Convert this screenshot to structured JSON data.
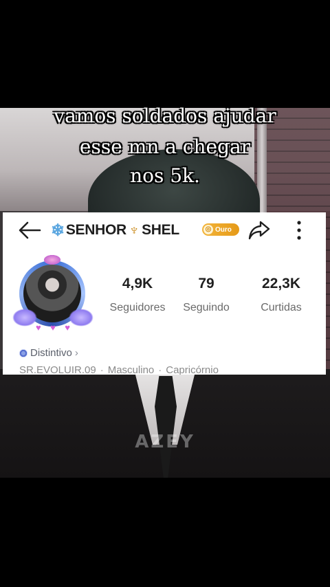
{
  "overlay": {
    "line1": "vamos soldados ajudar",
    "line2": "esse mn a chegar",
    "line3": "nos 5k.",
    "watermark": "AZEY"
  },
  "profile": {
    "username_prefix_icon": "snowflake",
    "username_part1": "SENHOR",
    "username_icon": "trident",
    "username_part2": "SHEL",
    "tier_badge": "Ouro",
    "tier_color": "#f3b43a",
    "stats": [
      {
        "value": "4,9K",
        "label": "Seguidores"
      },
      {
        "value": "79",
        "label": "Seguindo"
      },
      {
        "value": "22,3K",
        "label": "Curtidas"
      }
    ],
    "distintivo_label": "Distintivo",
    "meta": [
      "SR.EVOLUIR.09",
      "Masculino",
      "Capricórnio"
    ]
  }
}
